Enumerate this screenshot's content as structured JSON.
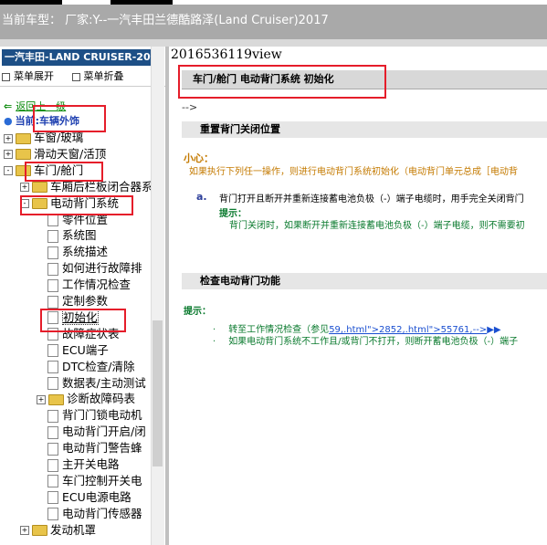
{
  "topbar": {
    "text": "当前车型：  厂家:Y--一汽丰田兰德酷路泽(Land Cruiser)2017"
  },
  "left": {
    "header": "一汽丰田-LAND CRUISER-201",
    "expand_all": "菜单展开",
    "collapse_all": "菜单折叠",
    "back": "返回上一级",
    "current": "当前:车辆外饰",
    "tree": [
      {
        "label": "车窗/玻璃",
        "kind": "folder",
        "state": "+"
      },
      {
        "label": "滑动天窗/活顶",
        "kind": "folder",
        "state": "+"
      },
      {
        "label": "车门/舱门",
        "kind": "folder",
        "state": "-"
      },
      {
        "label": "车厢后栏板闭合器系",
        "kind": "folder",
        "state": "+"
      },
      {
        "label": "电动背门系统",
        "kind": "folder",
        "state": "-"
      },
      {
        "label": "零件位置",
        "kind": "doc"
      },
      {
        "label": "系统图",
        "kind": "doc"
      },
      {
        "label": "系统描述",
        "kind": "doc"
      },
      {
        "label": "如何进行故障排",
        "kind": "doc"
      },
      {
        "label": "工作情况检查",
        "kind": "doc"
      },
      {
        "label": "定制参数",
        "kind": "doc"
      },
      {
        "label": "初始化",
        "kind": "doc",
        "selected": true
      },
      {
        "label": "故障症状表",
        "kind": "doc"
      },
      {
        "label": "ECU端子",
        "kind": "doc"
      },
      {
        "label": "DTC检查/清除",
        "kind": "doc"
      },
      {
        "label": "数据表/主动测试",
        "kind": "doc"
      },
      {
        "label": "诊断故障码表",
        "kind": "folder",
        "state": "+"
      },
      {
        "label": "背门门锁电动机",
        "kind": "doc"
      },
      {
        "label": "电动背门开启/闭",
        "kind": "doc"
      },
      {
        "label": "电动背门警告蜂",
        "kind": "doc"
      },
      {
        "label": "主开关电路",
        "kind": "doc"
      },
      {
        "label": "车门控制开关电",
        "kind": "doc"
      },
      {
        "label": "ECU电源电路",
        "kind": "doc"
      },
      {
        "label": "电动背门传感器",
        "kind": "doc"
      },
      {
        "label": "发动机罩",
        "kind": "folder",
        "state": "+"
      }
    ]
  },
  "right": {
    "view_id": "2016536119view",
    "title": "车门/舱门  电动背门系统  初始化",
    "arrow_text": "-->",
    "section1": "重置背门关闭位置",
    "caution_title": "小心：",
    "caution_body": "如果执行下列任一操作，则进行电动背门系统初始化（电动背门单元总成［电动背",
    "step_label": "a.",
    "step_text": "背门打开且断开并重新连接蓄电池负极（-）端子电缆时，用手完全关闭背门",
    "hint1_title": "提示：",
    "hint1_body": "背门关闭时，如果断开并重新连接蓄电池负极（-）端子电缆，则不需要初",
    "section2": "检查电动背门功能",
    "hint2_title": "提示：",
    "bullet1_prefix": "转至工作情况检查（参见",
    "bullet1_link": "59,.html\">2852,.html\">55761,-->",
    "bullet1_arrows": "▶▶",
    "bullet2": "如果电动背门系统不工作且/或背门不打开，则断开蓄电池负极（-）端子"
  },
  "colors": {
    "highlight": "#e51d2a",
    "header_blue": "#1d4f86",
    "hint_green": "#0a7a2e",
    "caution_orange": "#c47a00"
  }
}
